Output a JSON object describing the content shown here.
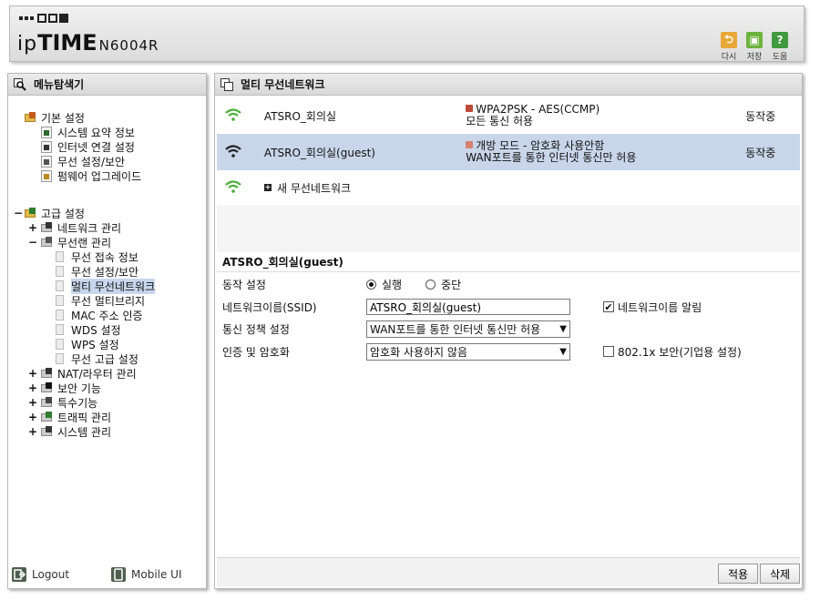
{
  "header": {
    "brand_time": "TIME",
    "brand_ip": "ip",
    "model": "N6004R",
    "buttons": [
      {
        "label": "다시",
        "icon": "undo-icon",
        "color": "#e8a93a"
      },
      {
        "label": "저장",
        "icon": "save-icon",
        "color": "#6cb33e"
      },
      {
        "label": "도움",
        "icon": "help-icon",
        "color": "#3f9a3f"
      }
    ]
  },
  "sidebar": {
    "title": "메뉴탐색기",
    "basic": {
      "label": "기본 설정",
      "items": [
        "시스템 요약 정보",
        "인터넷 연결 설정",
        "무선 설정/보안",
        "펌웨어 업그레이드"
      ]
    },
    "advanced": {
      "label": "고급 설정",
      "toggle": "−",
      "groups": [
        {
          "label": "네트워크 관리",
          "toggle": "+"
        },
        {
          "label": "무선랜 관리",
          "toggle": "−"
        },
        {
          "label": "NAT/라우터 관리",
          "toggle": "+"
        },
        {
          "label": "보안 기능",
          "toggle": "+"
        },
        {
          "label": "특수기능",
          "toggle": "+"
        },
        {
          "label": "트래픽 관리",
          "toggle": "+"
        },
        {
          "label": "시스템 관리",
          "toggle": "+"
        }
      ],
      "wireless_items": [
        "무선 접속 정보",
        "무선 설정/보안",
        "멀티 무선네트워크",
        "무선 멀티브리지",
        "MAC 주소 인증",
        "WDS 설정",
        "WPS 설정",
        "무선 고급 설정"
      ],
      "selected_item": "멀티 무선네트워크"
    },
    "footer": {
      "logout": "Logout",
      "mobile": "Mobile UI"
    }
  },
  "main": {
    "title": "멀티 무선네트워크",
    "networks": [
      {
        "ssid": "ATSRO_회의실",
        "security": "WPA2PSK - AES(CCMP)",
        "policy": "모든 통신 허용",
        "status": "동작중",
        "selected": false
      },
      {
        "ssid": "ATSRO_회의실(guest)",
        "security": "개방 모드 - 암호화 사용안함",
        "policy": "WAN포트를 통한 인터넷 통신만 허용",
        "status": "동작중",
        "selected": true
      }
    ],
    "add_label": "새 무선네트워크",
    "detail": {
      "title": "ATSRO_회의실(guest)",
      "op_label": "동작 설정",
      "op_run": "실행",
      "op_stop": "중단",
      "ssid_label": "네트워크이름(SSID)",
      "ssid_value": "ATSRO_회의실(guest)",
      "broadcast_label": "네트워크이름 알림",
      "policy_label": "통신 정책 설정",
      "policy_value": "WAN포트를 통한 인터넷 통신만 허용",
      "auth_label": "인증 및 암호화",
      "auth_value": "암호화 사용하지 않음",
      "dot1x_label": "802.1x 보안(기업용 설정)"
    },
    "buttons": {
      "apply": "적용",
      "delete": "삭제"
    }
  },
  "colors": {
    "selected_row": "#c9d6ea",
    "wifi_green": "#4caf3c",
    "wifi_dark": "#222222"
  }
}
